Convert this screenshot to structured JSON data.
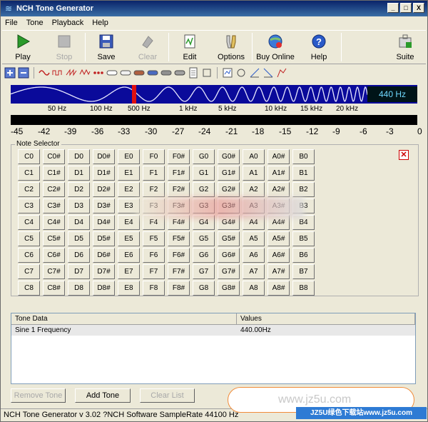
{
  "window": {
    "title": "NCH Tone Generator",
    "minimize": "_",
    "maximize": "□",
    "close": "X"
  },
  "menu": [
    "File",
    "Tone",
    "Playback",
    "Help"
  ],
  "toolbar": [
    {
      "label": "Play",
      "icon": "play-icon",
      "enabled": true
    },
    {
      "label": "Stop",
      "icon": "stop-icon",
      "enabled": false
    },
    {
      "label": "Save",
      "icon": "save-icon",
      "enabled": true
    },
    {
      "label": "Clear",
      "icon": "clear-icon",
      "enabled": false
    },
    {
      "label": "Edit",
      "icon": "edit-icon",
      "enabled": true
    },
    {
      "label": "Options",
      "icon": "options-icon",
      "enabled": true
    },
    {
      "label": "Buy Online",
      "icon": "buy-online-icon",
      "enabled": true
    },
    {
      "label": "Help",
      "icon": "help-icon",
      "enabled": true
    },
    {
      "label": "Suite",
      "icon": "suite-icon",
      "enabled": true
    }
  ],
  "frequency": {
    "readout": "440 Hz",
    "labels": [
      "50 Hz",
      "100 Hz",
      "500 Hz",
      "1 kHz",
      "5 kHz",
      "10 kHz",
      "15 kHz",
      "20 kHz"
    ]
  },
  "db_scale": [
    "-45",
    "-42",
    "-39",
    "-36",
    "-33",
    "-30",
    "-27",
    "-24",
    "-21",
    "-18",
    "-15",
    "-12",
    "-9",
    "-6",
    "-3",
    "0"
  ],
  "note_selector": {
    "title": "Note Selector",
    "rows": [
      [
        "C0",
        "C0#",
        "D0",
        "D0#",
        "E0",
        "F0",
        "F0#",
        "G0",
        "G0#",
        "A0",
        "A0#",
        "B0"
      ],
      [
        "C1",
        "C1#",
        "D1",
        "D1#",
        "E1",
        "F1",
        "F1#",
        "G1",
        "G1#",
        "A1",
        "A1#",
        "B1"
      ],
      [
        "C2",
        "C2#",
        "D2",
        "D2#",
        "E2",
        "F2",
        "F2#",
        "G2",
        "G2#",
        "A2",
        "A2#",
        "B2"
      ],
      [
        "C3",
        "C3#",
        "D3",
        "D3#",
        "E3",
        "F3",
        "F3#",
        "G3",
        "G3#",
        "A3",
        "A3#",
        "B3"
      ],
      [
        "C4",
        "C4#",
        "D4",
        "D4#",
        "E4",
        "F4",
        "F4#",
        "G4",
        "G4#",
        "A4",
        "A4#",
        "B4"
      ],
      [
        "C5",
        "C5#",
        "D5",
        "D5#",
        "E5",
        "F5",
        "F5#",
        "G5",
        "G5#",
        "A5",
        "A5#",
        "B5"
      ],
      [
        "C6",
        "C6#",
        "D6",
        "D6#",
        "E6",
        "F6",
        "F6#",
        "G6",
        "G6#",
        "A6",
        "A6#",
        "B6"
      ],
      [
        "C7",
        "C7#",
        "D7",
        "D7#",
        "E7",
        "F7",
        "F7#",
        "G7",
        "G7#",
        "A7",
        "A7#",
        "B7"
      ],
      [
        "C8",
        "C8#",
        "D8",
        "D8#",
        "E8",
        "F8",
        "F8#",
        "G8",
        "G8#",
        "A8",
        "A8#",
        "B8"
      ]
    ]
  },
  "tone_table": {
    "headers": [
      "Tone Data",
      "Values"
    ],
    "rows": [
      {
        "name": "Sine 1 Frequency",
        "value": "440.00Hz"
      }
    ]
  },
  "buttons": {
    "remove_tone": "Remove Tone",
    "add_tone": "Add Tone",
    "clear_list": "Clear List"
  },
  "status": "NCH Tone Generator v 3.02 ?NCH Software SampleRate 44100 Hz",
  "watermark": {
    "pill": "www.jz5u.com",
    "banner": "JZ5U绿色下载站www.jz5u.com"
  }
}
